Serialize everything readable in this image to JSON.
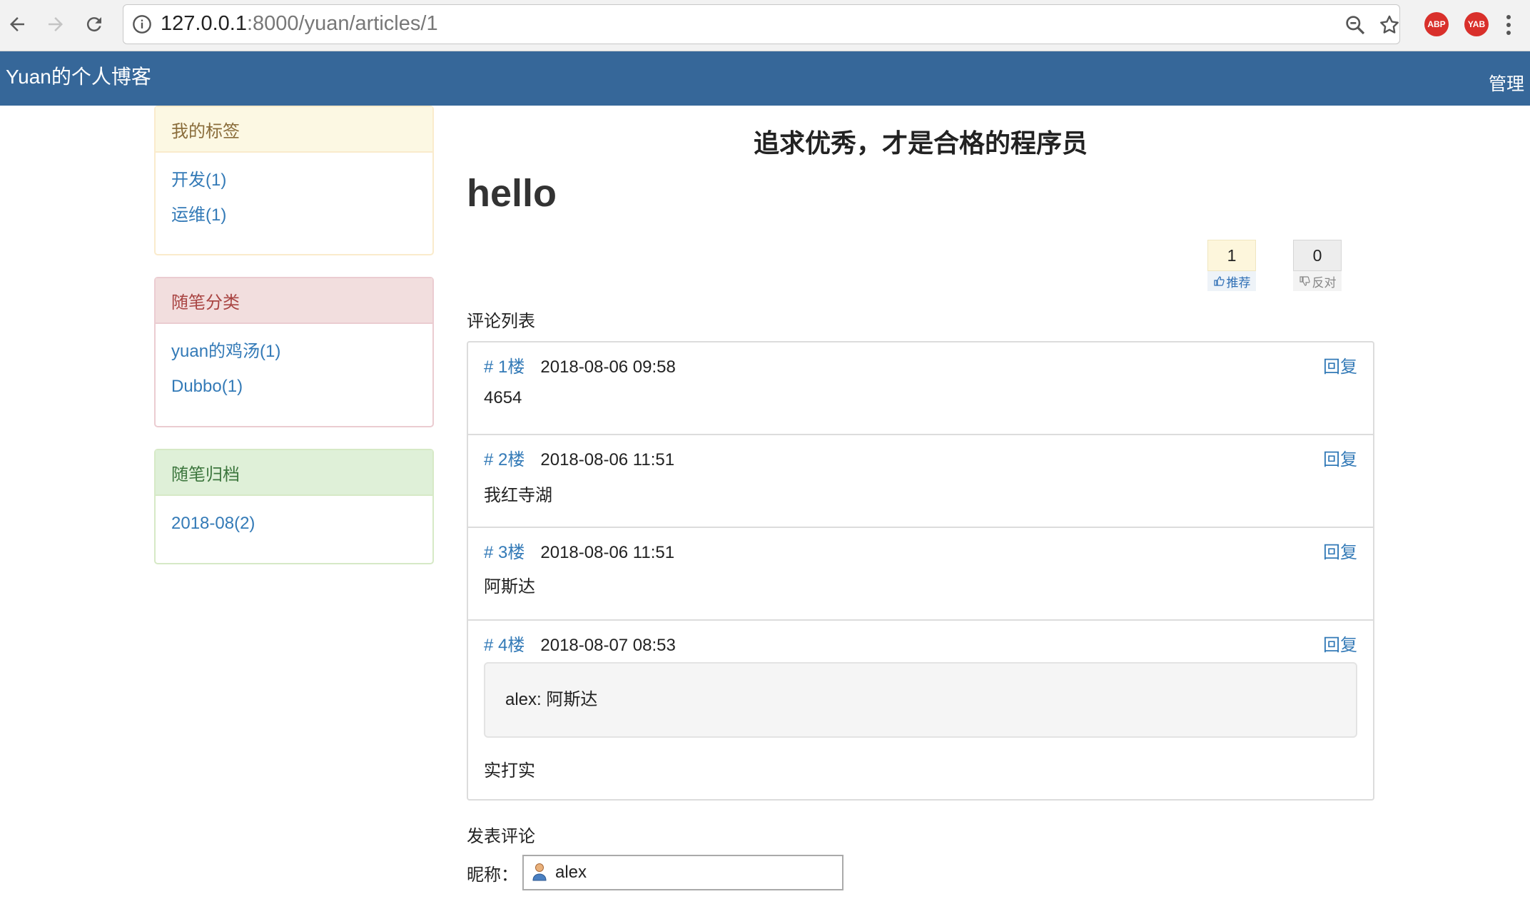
{
  "browser": {
    "url_host": "127.0.0.1",
    "url_rest": ":8000/yuan/articles/1",
    "extensions": [
      "ABP",
      "YAB"
    ]
  },
  "header": {
    "brand": "Yuan的个人博客",
    "manage": "管理",
    "bg_color": "#366799"
  },
  "sidebar": {
    "tags": {
      "title": "我的标签",
      "items": [
        "开发(1)",
        "运维(1)"
      ]
    },
    "categories": {
      "title": "随笔分类",
      "items": [
        "yuan的鸡汤(1)",
        "Dubbo(1)"
      ]
    },
    "archive": {
      "title": "随笔归档",
      "items": [
        "2018-08(2)"
      ]
    }
  },
  "main": {
    "site_title": "追求优秀，才是合格的程序员",
    "article_title": "hello",
    "votes": {
      "up_count": "1",
      "up_label": "推荐",
      "down_count": "0",
      "down_label": "反对"
    },
    "comment_list_label": "评论列表",
    "reply_label": "回复",
    "comments": [
      {
        "floor": "# 1楼",
        "time": "2018-08-06 09:58",
        "content": "4654"
      },
      {
        "floor": "# 2楼",
        "time": "2018-08-06 11:51",
        "content": "我红寺湖"
      },
      {
        "floor": "# 3楼",
        "time": "2018-08-06 11:51",
        "content": "阿斯达"
      },
      {
        "floor": "# 4楼",
        "time": "2018-08-07 08:53",
        "quote": "alex: 阿斯达",
        "content": "实打实"
      }
    ],
    "post_comment_label": "发表评论",
    "nickname_label": "昵称：",
    "nickname_value": "alex"
  }
}
